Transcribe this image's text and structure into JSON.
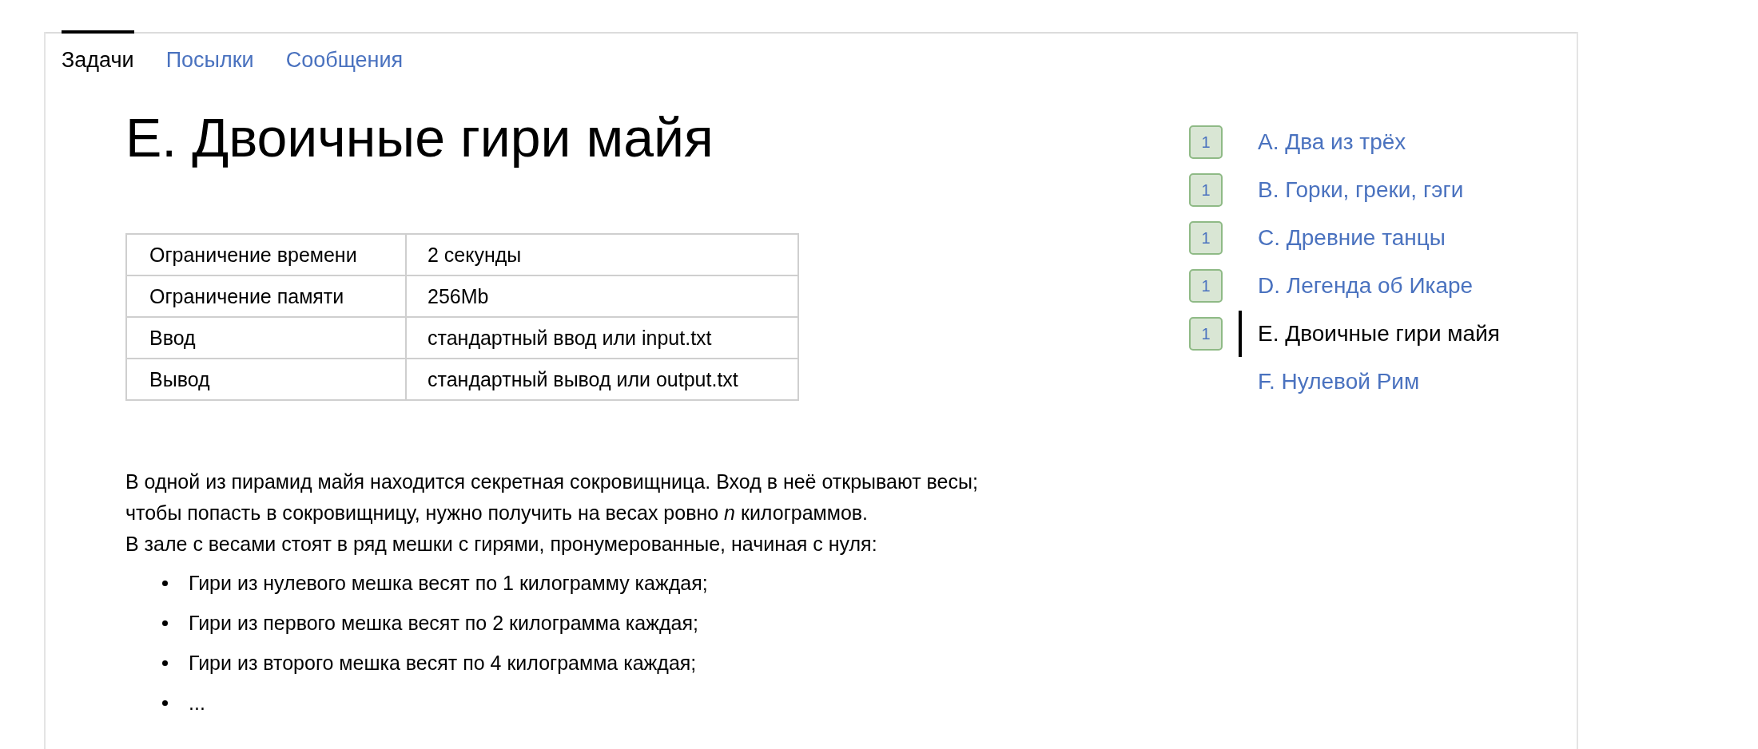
{
  "tabs": [
    {
      "label": "Задачи",
      "selected": true
    },
    {
      "label": "Посылки",
      "selected": false
    },
    {
      "label": "Сообщения",
      "selected": false
    }
  ],
  "problem": {
    "title": "E. Двоичные гири майя",
    "limits": [
      {
        "name": "Ограничение времени",
        "value": "2 секунды"
      },
      {
        "name": "Ограничение памяти",
        "value": "256Mb"
      },
      {
        "name": "Ввод",
        "value": "стандартный ввод или input.txt"
      },
      {
        "name": "Вывод",
        "value": "стандартный вывод или output.txt"
      }
    ],
    "statement": [
      "В одной из пирамид майя находится секретная сокровищница. Вход в неё открывают весы;",
      "чтобы попасть в сокровищницу, нужно получить на весах ровно *n* килограммов.",
      "В зале с весами стоят в ряд мешки с гирями, пронумерованные, начиная с нуля:"
    ],
    "bullets": [
      "Гири из нулевого мешка весят по 1 килограмму каждая;",
      "Гири из первого мешка весят по 2 килограмма каждая;",
      "Гири из второго мешка весят по 4 килограмма каждая;",
      "..."
    ]
  },
  "problem_list": [
    {
      "badge": "1",
      "label": "A. Два из трёх",
      "selected": false
    },
    {
      "badge": "1",
      "label": "B. Горки, греки, гэги",
      "selected": false
    },
    {
      "badge": "1",
      "label": "C. Древние танцы",
      "selected": false
    },
    {
      "badge": "1",
      "label": "D. Легенда об Икаре",
      "selected": false
    },
    {
      "badge": "1",
      "label": "E. Двоичные гири майя",
      "selected": true
    },
    {
      "label": "F. Нулевой Рим",
      "selected": false
    }
  ]
}
